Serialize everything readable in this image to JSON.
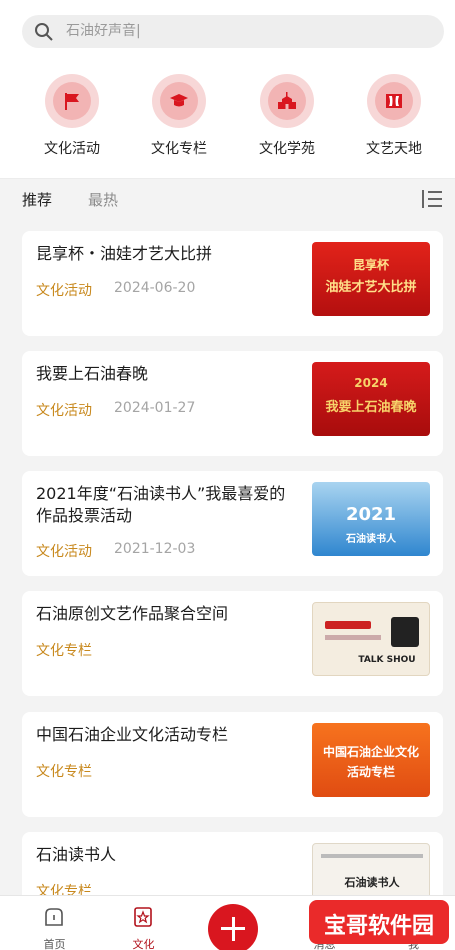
{
  "search": {
    "placeholder": "石油好声音|"
  },
  "categories": [
    {
      "label": "文化活动",
      "icon": "flag-icon"
    },
    {
      "label": "文化专栏",
      "icon": "graduation-cap-icon"
    },
    {
      "label": "文化学苑",
      "icon": "school-building-icon"
    },
    {
      "label": "文艺天地",
      "icon": "theater-stage-icon"
    }
  ],
  "tabs": [
    {
      "label": "推荐",
      "active": true
    },
    {
      "label": "最热",
      "active": false
    }
  ],
  "articles": [
    {
      "title": "昆享杯・油娃才艺大比拼",
      "tag": "文化活动",
      "date": "2024-06-20",
      "thumb_text": [
        "昆享杯",
        "油娃才艺大比拼"
      ]
    },
    {
      "title": "我要上石油春晚",
      "tag": "文化活动",
      "date": "2024-01-27",
      "thumb_text": [
        "2024",
        "我要上石油春晚"
      ]
    },
    {
      "title": "2021年度“石油读书人”我最喜爱的作品投票活动",
      "tag": "文化活动",
      "date": "2021-12-03",
      "thumb_text": [
        "2021",
        "石油读书人"
      ]
    },
    {
      "title": "石油原创文艺作品聚合空间",
      "tag": "文化专栏",
      "date": "",
      "thumb_text": [
        "TALK SHOU"
      ]
    },
    {
      "title": "中国石油企业文化活动专栏",
      "tag": "文化专栏",
      "date": "",
      "thumb_text": [
        "中国石油企业文化",
        "活动专栏"
      ]
    },
    {
      "title": "石油读书人",
      "tag": "文化专栏",
      "date": "",
      "thumb_text": [
        "石油读书人"
      ]
    }
  ],
  "bottom_nav": [
    {
      "label": "首页",
      "icon": "home-icon",
      "active": false
    },
    {
      "label": "文化",
      "icon": "culture-icon",
      "active": true
    },
    {
      "label": "",
      "icon": "plus-icon",
      "active": false
    },
    {
      "label": "消息",
      "icon": "message-icon",
      "active": false
    },
    {
      "label": "我",
      "icon": "user-icon",
      "active": false
    }
  ],
  "watermark": {
    "text": "宝哥软件园"
  },
  "colors": {
    "accent": "#d9161f",
    "tag": "#c8891e"
  }
}
